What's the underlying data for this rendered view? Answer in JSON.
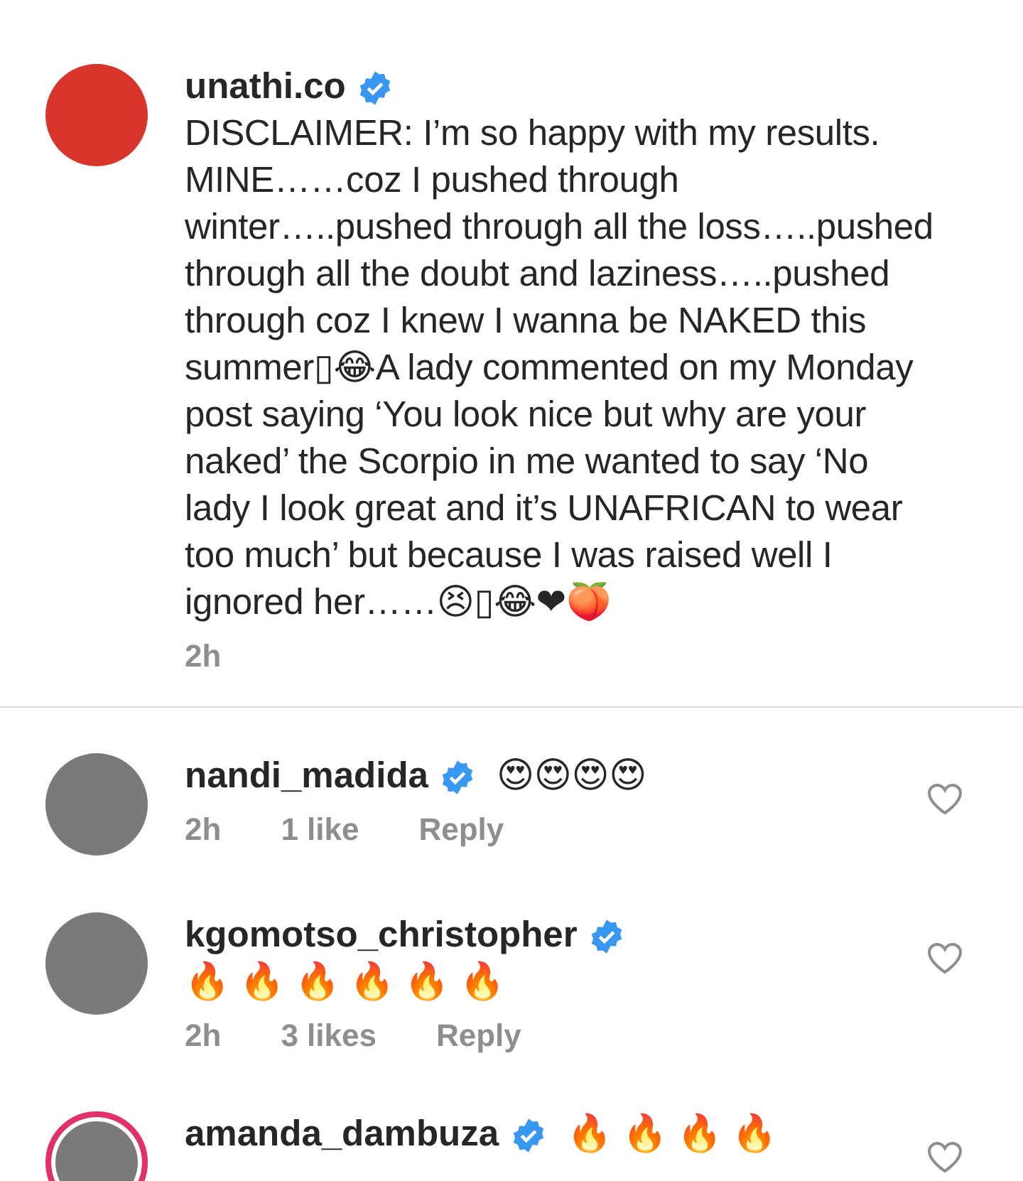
{
  "caption": {
    "username": "unathi.co",
    "verified": true,
    "time": "2h",
    "text": "DISCLAIMER: I’m so happy with my results. MINE……coz I pushed through winter…..pushed through all the loss…..pushed through all the doubt and laziness…..pushed through coz I knew I wanna be NAKED this summer▯😂A lady commented on my Monday post saying ‘You look nice but why are your naked’ the Scorpio in me wanted to say ‘No lady I look great and it’s UNAFRICAN to wear too much’ but because I was raised well I ignored her……😣▯😂❤🍑"
  },
  "comments": [
    {
      "username": "nandi_madida",
      "verified": true,
      "story_ring": false,
      "liked": false,
      "time": "2h",
      "likes": "1 like",
      "reply": "Reply",
      "text": "😍😍😍😍"
    },
    {
      "username": "kgomotso_christopher",
      "verified": true,
      "story_ring": false,
      "liked": false,
      "time": "2h",
      "likes": "3 likes",
      "reply": "Reply",
      "text": "🔥 🔥 🔥 🔥 🔥 🔥"
    },
    {
      "username": "amanda_dambuza",
      "verified": true,
      "story_ring": true,
      "liked": false,
      "text": "🔥 🔥 🔥 🔥"
    }
  ]
}
